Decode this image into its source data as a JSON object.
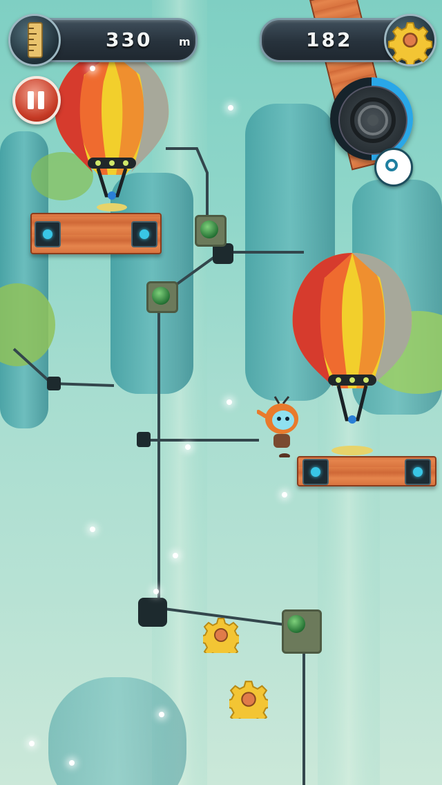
{
  "hud": {
    "distance_value": "330",
    "distance_unit": "m",
    "gears_value": "182"
  },
  "icons": {
    "distance": "ruler-icon",
    "gears": "gear-icon",
    "pause": "pause-icon",
    "powerup": "powerup-ring-icon",
    "extra": "ring-target-icon"
  },
  "colors": {
    "pause": "#c63a25",
    "hud_pill": "#27323c",
    "powerup_fill": "#2aa7e8",
    "gear_gold": "#f3c534"
  },
  "powerup_charge": 0.5
}
